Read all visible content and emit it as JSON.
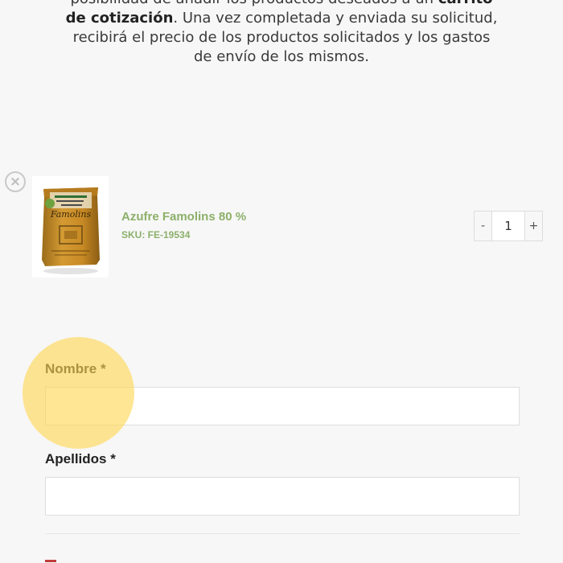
{
  "intro": {
    "line1_pre": "posibilidad de añadir los productos deseados a un ",
    "line1_bold": "carrito",
    "line2_bold": "de cotización",
    "line2_post": ". Una vez completada y enviada su solicitud,",
    "line3": "recibirá el precio de los productos solicitados y los gastos",
    "line4": "de envío de los mismos."
  },
  "cart": {
    "remove_icon": "×",
    "item": {
      "name": "Azufre Famolins 80 %",
      "sku": "SKU: FE-19534",
      "bag_label": "Famolins",
      "quantity": "1",
      "decrement_label": "-",
      "increment_label": "+"
    }
  },
  "form": {
    "nombre_label": "Nombre *",
    "nombre_value": "",
    "apellidos_label": "Apellidos *",
    "apellidos_value": ""
  },
  "colors": {
    "accent_green": "#8cb06a",
    "highlight": "#ffd652"
  }
}
